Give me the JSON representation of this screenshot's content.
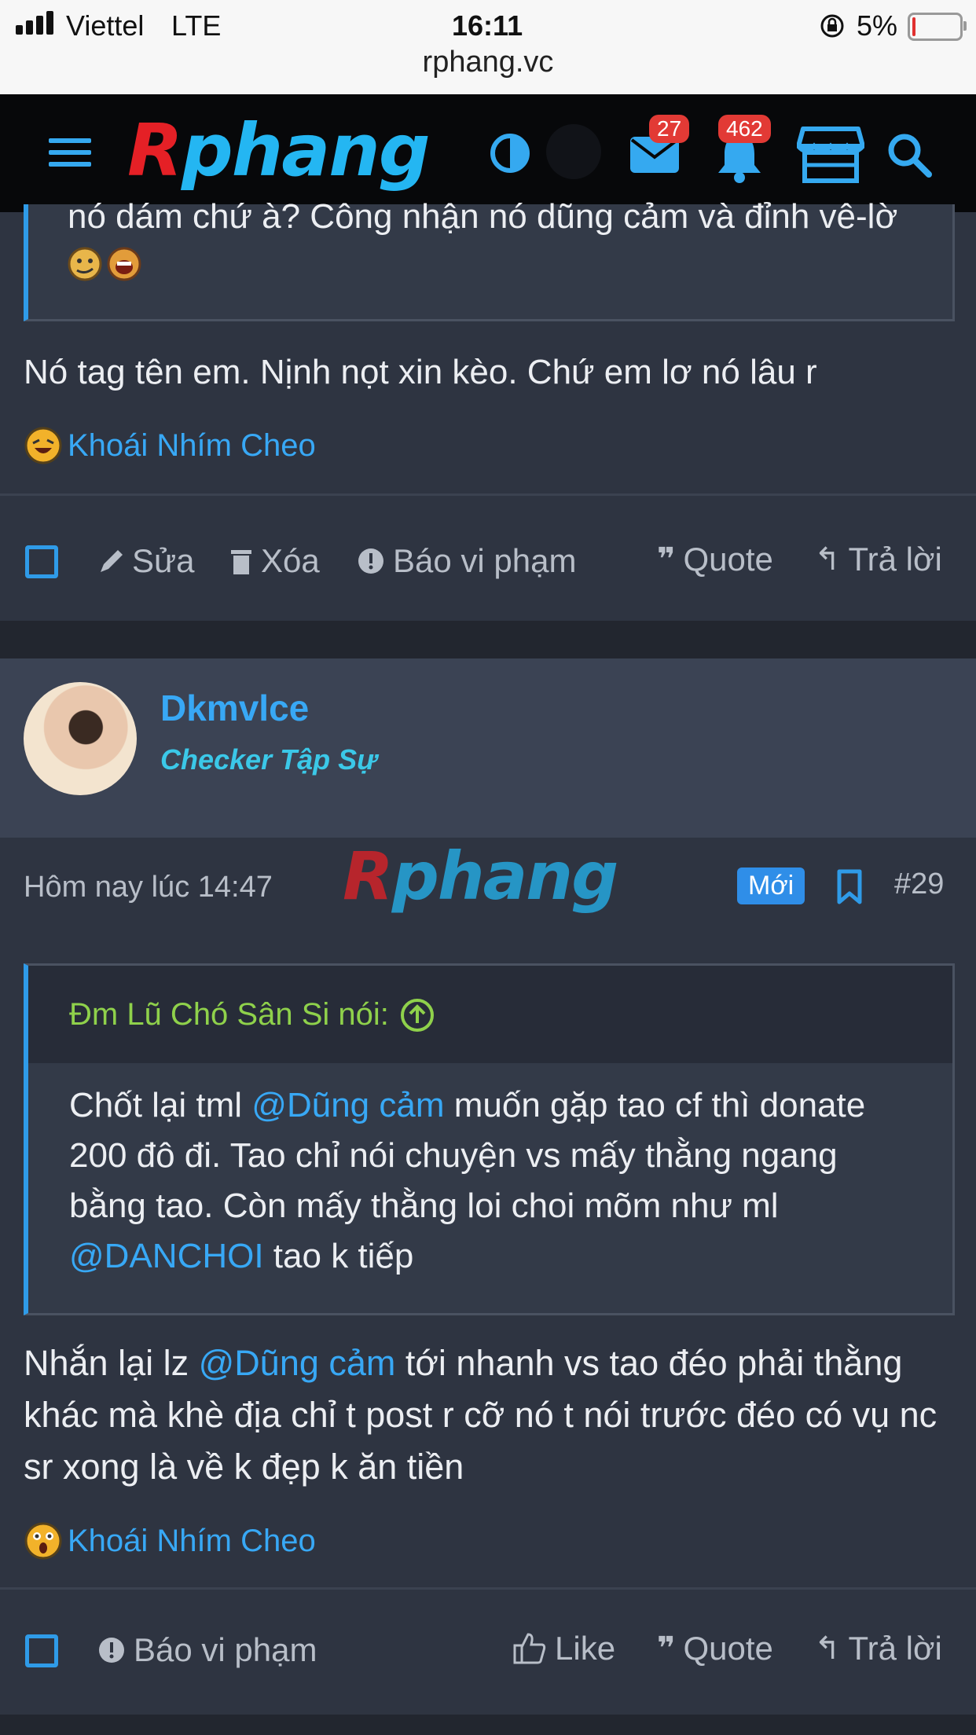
{
  "status_bar": {
    "carrier": "Viettel",
    "network": "LTE",
    "time": "16:11",
    "battery": "5%",
    "url": "rphang.vc"
  },
  "header": {
    "logo_r": "R",
    "logo_rest": "phang",
    "messages_count": "27",
    "alerts_count": "462"
  },
  "post1": {
    "quote_tail": "nó dám chứ à? Công nhận nó dũng cảm và đỉnh vê-lờ",
    "body": "Nó tag tên em. Nịnh nọt xin kèo. Chứ em lơ nó lâu r",
    "reaction_users": "Khoái Nhím Cheo",
    "actions": {
      "edit": "Sửa",
      "delete": "Xóa",
      "report": "Báo vi phạm",
      "quote": "Quote",
      "reply": "Trả lời"
    }
  },
  "post2": {
    "username": "Dkmvlce",
    "user_title": "Checker Tập Sự",
    "timestamp": "Hôm nay lúc 14:47",
    "watermark_r": "R",
    "watermark_rest": "phang",
    "new_label": "Mới",
    "post_number": "#29",
    "quote_author": "Đm Lũ Chó Sân Si nói:",
    "quote_part1": "Chốt lại tml ",
    "quote_mention1": "@Dũng cảm",
    "quote_part2": " muốn gặp tao cf thì donate 200 đô đi. Tao chỉ nói chuyện vs mấy thằng ngang bằng tao. Còn mấy thằng loi choi mõm như ml ",
    "quote_mention2": "@DANCHOI",
    "quote_part3": " tao k tiếp",
    "body_part1": "Nhắn lại lz ",
    "body_mention": "@Dũng cảm",
    "body_part2": " tới nhanh vs tao đéo phải thằng khác mà khè địa chỉ t post r cỡ nó t nói trước đéo có vụ nc sr xong là về k đẹp k ăn tiền",
    "reaction_users": "Khoái Nhím Cheo",
    "actions": {
      "report": "Báo vi phạm",
      "like": "Like",
      "quote": "Quote",
      "reply": "Trả lời"
    }
  }
}
